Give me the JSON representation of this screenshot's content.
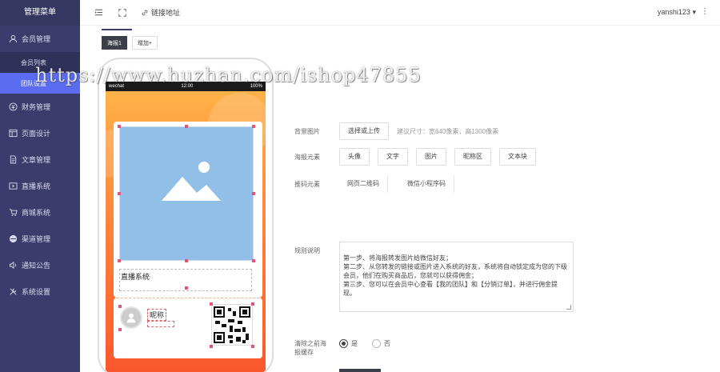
{
  "sidebar": {
    "title": "管理菜单",
    "items": [
      {
        "label": "会员管理",
        "icon": "user-icon"
      },
      {
        "label": "会员列表",
        "icon": ""
      },
      {
        "label": "团队设置",
        "icon": ""
      },
      {
        "label": "财务管理",
        "icon": "finance-icon"
      },
      {
        "label": "页面设计",
        "icon": "layout-icon"
      },
      {
        "label": "文章管理",
        "icon": "document-icon"
      },
      {
        "label": "直播系统",
        "icon": "video-icon"
      },
      {
        "label": "商城系统",
        "icon": "cart-icon"
      },
      {
        "label": "渠道管理",
        "icon": "channel-icon"
      },
      {
        "label": "通知公告",
        "icon": "speaker-icon"
      },
      {
        "label": "系统设置",
        "icon": "tools-icon"
      }
    ]
  },
  "topbar": {
    "link_label": "链接地址",
    "user": "yanshi123"
  },
  "tabs": [
    {
      "label": "海报1"
    },
    {
      "label": "增加+"
    }
  ],
  "phone": {
    "carrier": "wechat",
    "time": "12:00",
    "battery": "100%",
    "caption": "直播系统",
    "nickname": "昵称"
  },
  "form": {
    "bg_label": "背景图片",
    "upload_button": "选择或上传",
    "bg_hint": "建议尺寸：宽640像素，高1300像素",
    "elements_label": "海报元素",
    "elements": [
      "头像",
      "文字",
      "图片",
      "昵称区",
      "文本块"
    ],
    "qr_label": "推码元素",
    "qr_elements": [
      "网页二维码",
      "微信小程序码"
    ],
    "desc_label": "规则说明",
    "desc_text": "第一步、将海报转发图片给微信好友；\n第二步、从您转发的链接或图片进入系统的好友，系统将自动锁定成为您的下级会员，他们在购买商品后，您就可以获得佣金；\n第三步、您可以在会员中心查看【我的团队】和【分销订单】，并进行佣金提现。",
    "cache_label": "清除之前海报缓存",
    "yes": "是",
    "no": "否"
  },
  "watermark": "https://www.huzhan.com/ishop47855",
  "colors": {
    "sidebar": "#3a3d6b",
    "active": "#5b6cf0",
    "poster_top": "#ffb54a",
    "poster_bottom": "#f8542b"
  }
}
